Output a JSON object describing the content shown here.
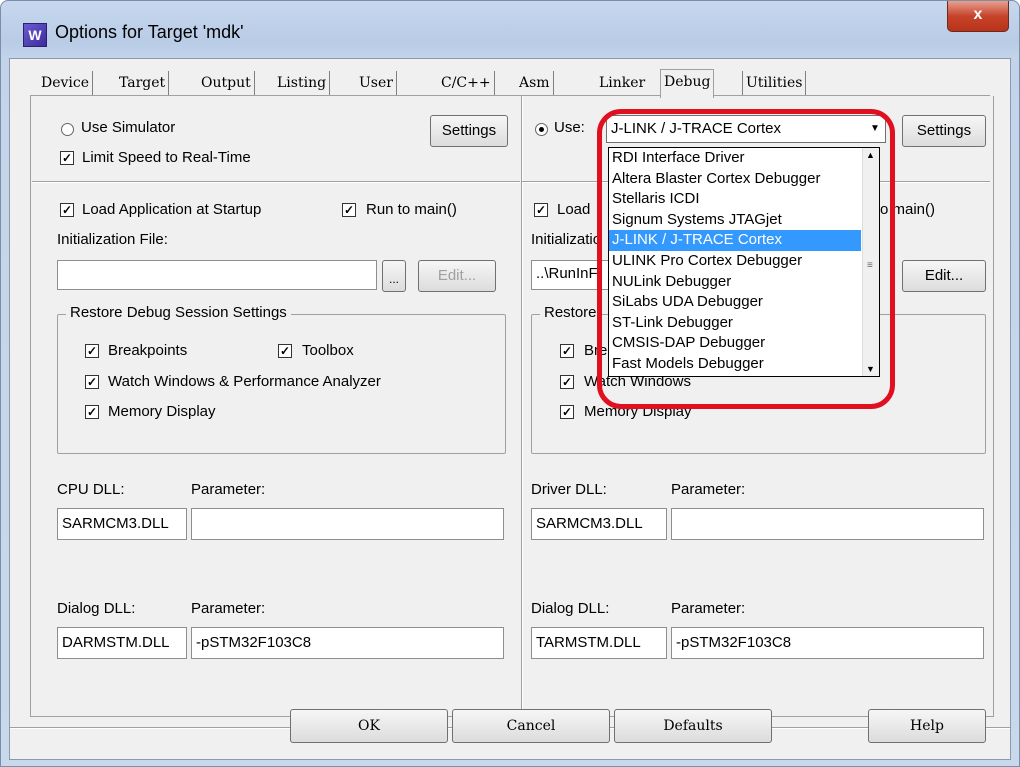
{
  "window": {
    "title": "Options for Target 'mdk'",
    "close_label": "x",
    "icon_letter": "W"
  },
  "tabs": [
    "Device",
    "Target",
    "Output",
    "Listing",
    "User",
    "C/C++",
    "Asm",
    "Linker",
    "Debug",
    "Utilities"
  ],
  "active_tab": "Debug",
  "left": {
    "use_simulator": "Use Simulator",
    "settings": "Settings",
    "limit_speed": "Limit Speed to Real-Time",
    "load_app": "Load Application at Startup",
    "run_to_main": "Run to main()",
    "init_file_label": "Initialization File:",
    "init_file_value": "",
    "browse": "...",
    "edit": "Edit...",
    "restore_group": "Restore Debug Session Settings",
    "breakpoints": "Breakpoints",
    "toolbox": "Toolbox",
    "watch_windows": "Watch Windows & Performance Analyzer",
    "memory_display": "Memory Display",
    "cpu_dll_label": "CPU DLL:",
    "cpu_param_label": "Parameter:",
    "cpu_dll_value": "SARMCM3.DLL",
    "cpu_param_value": "",
    "dialog_dll_label": "Dialog DLL:",
    "dialog_param_label": "Parameter:",
    "dialog_dll_value": "DARMSTM.DLL",
    "dialog_param_value": "-pSTM32F103C8"
  },
  "right": {
    "use": "Use:",
    "debugger_selected": "J-LINK / J-TRACE Cortex",
    "settings": "Settings",
    "load_partial": "Load",
    "run_to_main_partial": "o main()",
    "init_partial": "Initializatio",
    "init_value_partial": "..\\RunInF",
    "edit": "Edit...",
    "restore_partial": "Restore",
    "breakpoints_partial": "Bre",
    "watch_partial": "Watch Windows",
    "memory_display": "Memory Display",
    "driver_dll_label": "Driver DLL:",
    "driver_param_label": "Parameter:",
    "driver_dll_value": "SARMCM3.DLL",
    "driver_param_value": "",
    "dialog_dll_label": "Dialog DLL:",
    "dialog_param_label": "Parameter:",
    "dialog_dll_value": "TARMSTM.DLL",
    "dialog_param_value": "-pSTM32F103C8"
  },
  "dropdown": {
    "items": [
      "RDI Interface Driver",
      "Altera Blaster Cortex Debugger",
      "Stellaris ICDI",
      "Signum Systems JTAGjet",
      "J-LINK / J-TRACE Cortex",
      "ULINK Pro Cortex Debugger",
      "NULink Debugger",
      "SiLabs UDA Debugger",
      "ST-Link Debugger",
      "CMSIS-DAP Debugger",
      "Fast Models Debugger"
    ],
    "selected_index": 4
  },
  "buttons": {
    "ok": "OK",
    "cancel": "Cancel",
    "defaults": "Defaults",
    "help": "Help"
  },
  "colors": {
    "highlight": "#e01020",
    "selection": "#3399ff"
  }
}
